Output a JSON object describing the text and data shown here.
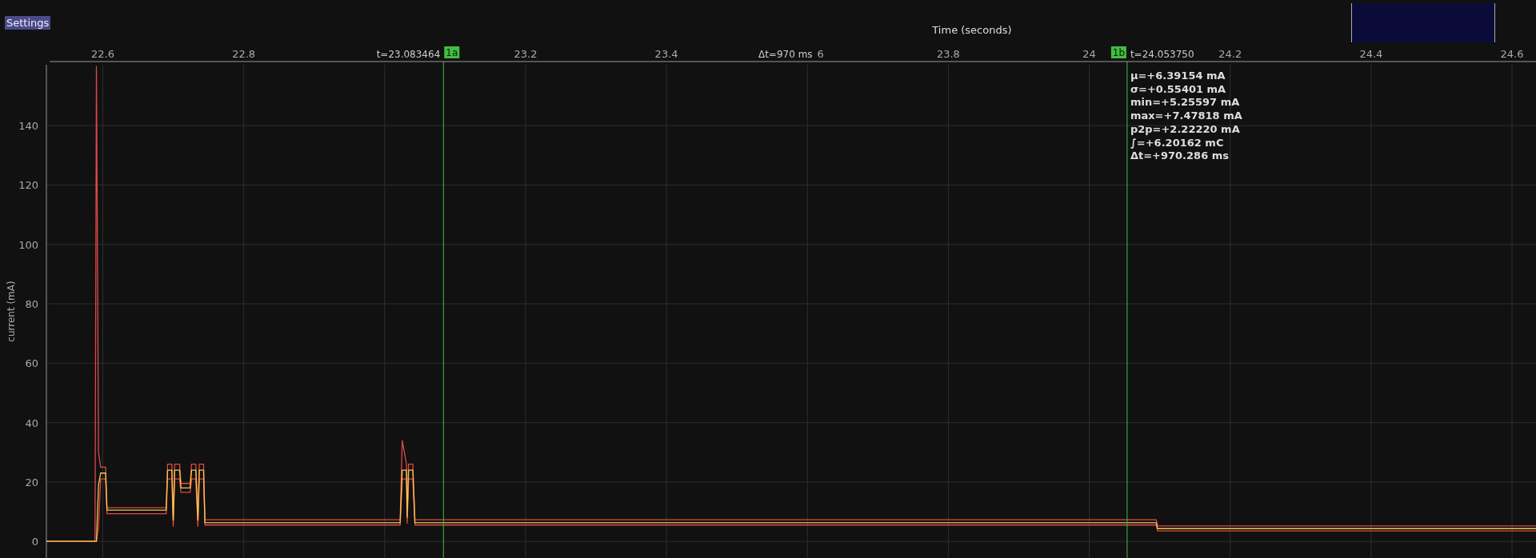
{
  "settings_button": "Settings",
  "plot": {
    "delta_label": "Δt=970 ms",
    "clipped_tick_label": "6",
    "statistics": [
      "μ=+6.39154 mA",
      "σ=+0.55401 mA",
      "min=+5.25597 mA",
      "max=+7.47818 mA",
      "p2p=+2.22220 mA",
      "∫=+6.20162 mC",
      "Δt=+970.286 ms"
    ],
    "chart_data": {
      "type": "line",
      "xlabel": "Time (seconds)",
      "ylabel": "current (mA)",
      "grid": true,
      "x": [
        22.52,
        22.589,
        22.591,
        22.594,
        22.597,
        22.604,
        22.606,
        22.69,
        22.692,
        22.698,
        22.7,
        22.702,
        22.709,
        22.711,
        22.724,
        22.726,
        22.732,
        22.735,
        22.737,
        22.743,
        22.745,
        23.022,
        23.025,
        23.031,
        23.032,
        23.034,
        23.04,
        23.043,
        24.095,
        24.097,
        24.634
      ],
      "series": [
        {
          "color": "#e04848",
          "values": [
            0,
            0,
            160,
            30,
            25,
            25,
            11.3,
            11.3,
            26,
            26,
            9,
            26,
            26,
            19.5,
            19.5,
            26,
            26,
            9,
            26,
            26,
            7.3,
            7.3,
            34,
            26,
            10,
            26,
            26,
            7.3,
            7.3,
            5.2,
            5.2
          ]
        },
        {
          "color": "#e04848",
          "values": [
            0,
            0,
            0,
            5,
            21,
            21,
            9.3,
            9.3,
            21,
            21,
            5,
            21,
            21,
            16.5,
            16.5,
            21,
            21,
            5,
            21,
            21,
            5.5,
            5.5,
            21,
            21,
            6,
            21,
            21,
            5.5,
            5.5,
            3.5,
            3.5
          ]
        },
        {
          "color": "#f2c94c",
          "values": [
            0,
            0,
            0,
            19,
            23,
            23,
            10.5,
            10.5,
            24,
            24,
            7,
            24,
            24,
            18,
            18,
            24,
            24,
            7,
            24,
            24,
            6.3,
            6.3,
            24,
            24,
            8,
            24,
            24,
            6.3,
            6.3,
            4.3,
            4.3
          ]
        }
      ],
      "xlim": [
        22.52,
        24.634
      ],
      "ylim": [
        -5.6,
        160.5
      ],
      "xticks": [
        22.6,
        22.8,
        23.2,
        23.4,
        23.8,
        24,
        24.2,
        24.4,
        24.6
      ],
      "yticks": [
        0,
        20,
        40,
        60,
        80,
        100,
        120,
        140
      ],
      "ref_lines": [
        {
          "axis": "x",
          "value": 23.083464,
          "label": "1a",
          "color": "#3fbf3f"
        },
        {
          "axis": "x",
          "value": 24.05375,
          "label": "1b",
          "color": "#3fbf3f"
        }
      ],
      "annotations": [
        "t=23.083464",
        "t=24.053750"
      ]
    }
  }
}
